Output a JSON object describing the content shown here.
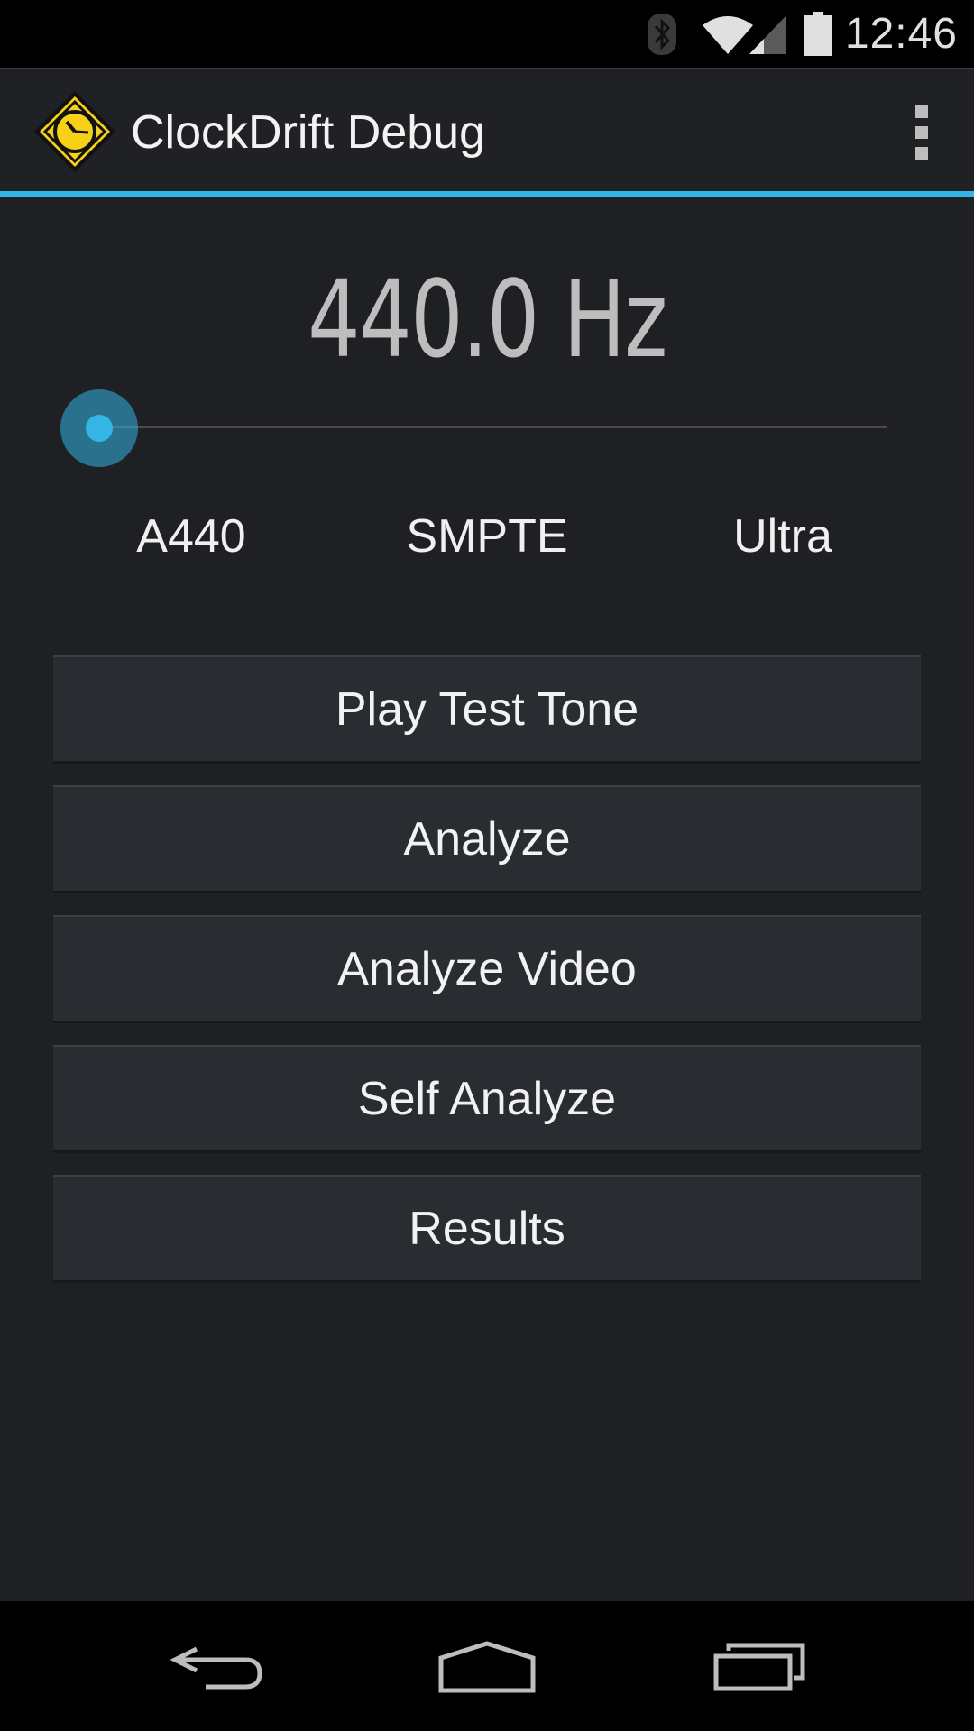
{
  "status_bar": {
    "time": "12:46",
    "icons": [
      "bluetooth-icon",
      "wifi-icon",
      "cell-signal-icon",
      "battery-icon"
    ]
  },
  "action_bar": {
    "title": "ClockDrift Debug",
    "logo_icon": "clock-warning-sign-icon",
    "overflow_icon": "overflow-menu-icon"
  },
  "frequency": {
    "display": "440.0 Hz",
    "slider_level": 0.0
  },
  "presets": [
    "A440",
    "SMPTE",
    "Ultra"
  ],
  "buttons": {
    "play_test_tone": "Play Test Tone",
    "analyze": "Analyze",
    "analyze_video": "Analyze Video",
    "self_analyze": "Self Analyze",
    "results": "Results"
  },
  "nav_bar": {
    "icons": [
      "back-icon",
      "home-icon",
      "recents-icon"
    ]
  },
  "colors": {
    "accent": "#33b5e5",
    "background": "#1f2023",
    "button": "#292c30",
    "logo_yellow": "#f7d117"
  }
}
